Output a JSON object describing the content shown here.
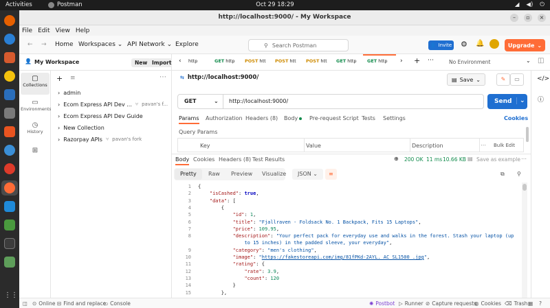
{
  "os": {
    "activities": "Activities",
    "app_name": "Postman",
    "clock": "Oct 29  18:29"
  },
  "window": {
    "title": "http://localhost:9000/ - My Workspace"
  },
  "menu": [
    "File",
    "Edit",
    "View",
    "Help"
  ],
  "header": {
    "home": "Home",
    "workspaces": "Workspaces",
    "api_network": "API Network",
    "explore": "Explore",
    "search_placeholder": "Search Postman",
    "invite": "Invite",
    "upgrade": "Upgrade",
    "environment": "No Environment"
  },
  "sidebar": {
    "workspace": "My Workspace",
    "new_btn": "New",
    "import_btn": "Import",
    "rail": [
      "Collections",
      "Environments",
      "History"
    ],
    "items": [
      {
        "label": "admin",
        "fork": ""
      },
      {
        "label": "Ecom Express API Dev ...",
        "fork": "pavan's f..."
      },
      {
        "label": "Ecom Express API Dev Guide",
        "fork": ""
      },
      {
        "label": "New Collection",
        "fork": ""
      },
      {
        "label": "Razorpay APIs",
        "fork": "pavan's fork"
      }
    ]
  },
  "tabs": [
    {
      "method": "",
      "label": "http"
    },
    {
      "method": "GET",
      "label": "http"
    },
    {
      "method": "POST",
      "label": "htt"
    },
    {
      "method": "POST",
      "label": "htt"
    },
    {
      "method": "POST",
      "label": "htt"
    },
    {
      "method": "GET",
      "label": "http"
    },
    {
      "method": "GET",
      "label": "http"
    }
  ],
  "request": {
    "title": "http://localhost:9000/",
    "save": "Save",
    "method": "GET",
    "url": "http://localhost:9000/",
    "send": "Send",
    "tabs": [
      "Params",
      "Authorization",
      "Headers (8)",
      "Body",
      "Pre-request Script",
      "Tests",
      "Settings"
    ],
    "cookies": "Cookies",
    "query_params_title": "Query Params",
    "columns": [
      "Key",
      "Value",
      "Description",
      "Bulk Edit"
    ]
  },
  "response": {
    "tabs": [
      "Body",
      "Cookies",
      "Headers (8)",
      "Test Results"
    ],
    "status": "200 OK",
    "time": "11 ms",
    "size": "10.66 KB",
    "save_example": "Save as example",
    "views": [
      "Pretty",
      "Raw",
      "Preview",
      "Visualize"
    ],
    "format": "JSON",
    "lines": [
      {
        "n": "1",
        "html": "{"
      },
      {
        "n": "2",
        "html": "    <span class='k'>\"isCashed\"</span>: <span class='b'>true</span>,"
      },
      {
        "n": "3",
        "html": "    <span class='k'>\"data\"</span>: ["
      },
      {
        "n": "4",
        "html": "        {"
      },
      {
        "n": "5",
        "html": "            <span class='k'>\"id\"</span>: <span class='n'>1</span>,"
      },
      {
        "n": "6",
        "html": "            <span class='k'>\"title\"</span>: <span class='s'>\"Fjallraven - Foldsack No. 1 Backpack, Fits 15 Laptops\"</span>,"
      },
      {
        "n": "7",
        "html": "            <span class='k'>\"price\"</span>: <span class='n'>109.95</span>,"
      },
      {
        "n": "8",
        "html": "            <span class='k'>\"description\"</span>: <span class='s'>\"Your perfect pack for everyday use and walks in the forest. Stash your laptop (up</span>"
      },
      {
        "n": "",
        "html": "                <span class='s'>to 15 inches) in the padded sleeve, your everyday\"</span>,"
      },
      {
        "n": "9",
        "html": "            <span class='k'>\"category\"</span>: <span class='s'>\"men's clothing\"</span>,"
      },
      {
        "n": "10",
        "html": "            <span class='k'>\"image\"</span>: <span class='s'>\"</span><span class='lnk'>https://fakestoreapi.com/img/81fPKd-2AYL._AC_SL1500_.jpg</span><span class='s'>\"</span>,"
      },
      {
        "n": "11",
        "html": "            <span class='k'>\"rating\"</span>: {"
      },
      {
        "n": "12",
        "html": "                <span class='k'>\"rate\"</span>: <span class='n'>3.9</span>,"
      },
      {
        "n": "13",
        "html": "                <span class='k'>\"count\"</span>: <span class='n'>120</span>"
      },
      {
        "n": "14",
        "html": "            }"
      },
      {
        "n": "15",
        "html": "        },"
      }
    ]
  },
  "statusbar": {
    "online": "Online",
    "find_replace": "Find and replace",
    "console": "Console",
    "postbot": "Postbot",
    "runner": "Runner",
    "capture": "Capture requests",
    "cookies": "Cookies",
    "trash": "Trash"
  },
  "colors": {
    "accent": "#ff6c37",
    "primary": "#1f6fd1",
    "get": "#0f8a4a",
    "post": "#ce8a00",
    "status_ok": "#0f8a4a"
  }
}
